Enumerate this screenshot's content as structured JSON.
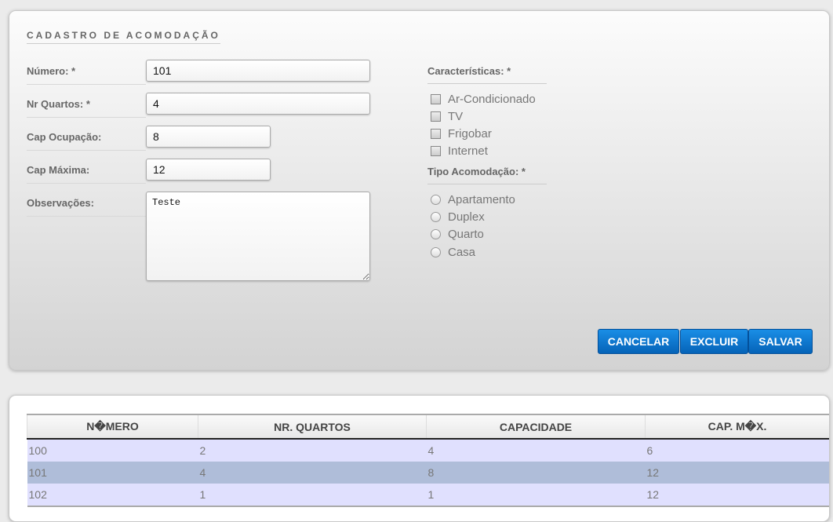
{
  "form": {
    "title": "CADASTRO DE ACOMODAÇÃO",
    "fields": [
      {
        "label": "Número: *",
        "value": "101"
      },
      {
        "label": "Nr Quartos: *",
        "value": "4"
      },
      {
        "label": "Cap Ocupação:",
        "value": "8"
      },
      {
        "label": "Cap Máxima:",
        "value": "12"
      },
      {
        "label": "Observações:",
        "value": "Teste"
      }
    ],
    "features_label": "Características: *",
    "features": [
      "Ar-Condicionado",
      "TV",
      "Frigobar",
      "Internet"
    ],
    "type_label": "Tipo Acomodação: *",
    "types": [
      "Apartamento",
      "Duplex",
      "Quarto",
      "Casa"
    ],
    "buttons": {
      "cancel": "CANCELAR",
      "delete": "EXCLUIR",
      "save": "SALVAR"
    }
  },
  "table": {
    "headers": [
      "N�MERO",
      "NR. QUARTOS",
      "CAPACIDADE",
      "CAP. M�X."
    ],
    "rows": [
      [
        "100",
        "2",
        "4",
        "6"
      ],
      [
        "101",
        "4",
        "8",
        "12"
      ],
      [
        "102",
        "1",
        "1",
        "12"
      ]
    ]
  }
}
